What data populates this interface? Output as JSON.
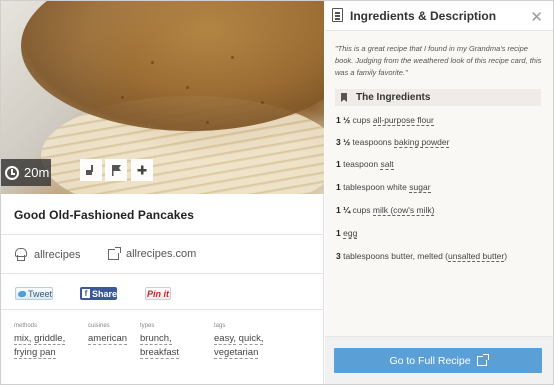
{
  "hero": {
    "time": "20m"
  },
  "recipe": {
    "title": "Good Old-Fashioned Pancakes",
    "source_name": "allrecipes",
    "source_site": "allrecipes.com"
  },
  "share": {
    "twitter_label": "Tweet",
    "facebook_label": "Share",
    "pinterest_label": "Pin it"
  },
  "tags": {
    "methods": {
      "label": "methods",
      "values": [
        "mix,",
        "griddle,",
        "frying pan"
      ]
    },
    "cuisines": {
      "label": "cuisines",
      "values": [
        "american"
      ]
    },
    "types": {
      "label": "types",
      "values": [
        "brunch,",
        "breakfast"
      ]
    },
    "tags": {
      "label": "tags",
      "values": [
        "easy,",
        "quick,",
        "vegetarian"
      ]
    }
  },
  "panel": {
    "title": "Ingredients & Description",
    "close_glyph": "✕",
    "description": "\"This is a great recipe that I found in my Grandma's recipe book. Judging from the weathered look of this recipe card, this was a family favorite.\"",
    "ingredients_heading": "The Ingredients",
    "ingredients": [
      {
        "qty": "1 ½",
        "pre": " cups ",
        "item": "all-purpose flour",
        "post": ""
      },
      {
        "qty": "3 ½",
        "pre": " teaspoons ",
        "item": "baking powder",
        "post": ""
      },
      {
        "qty": "1",
        "pre": " teaspoon ",
        "item": "salt",
        "post": ""
      },
      {
        "qty": "1",
        "pre": " tablespoon white ",
        "item": "sugar",
        "post": ""
      },
      {
        "qty": "1 ¼",
        "pre": " cups ",
        "item": "milk (cow's milk)",
        "post": ""
      },
      {
        "qty": "1",
        "pre": " ",
        "item": "egg",
        "post": ""
      },
      {
        "qty": "3",
        "pre": " tablespoons butter, melted (",
        "item": "unsalted butter",
        "post": ")"
      }
    ],
    "cta_label": "Go to Full Recipe"
  }
}
